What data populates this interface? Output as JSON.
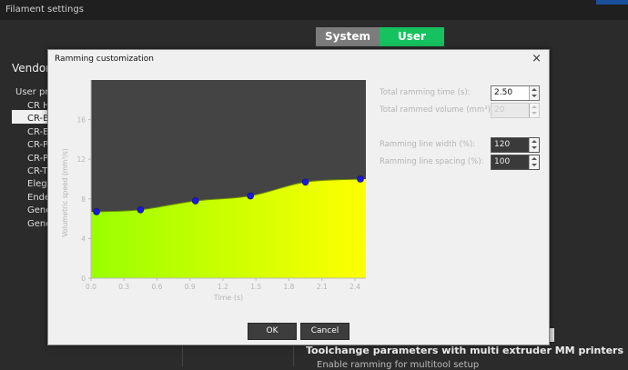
{
  "window": {
    "title": "Filament settings"
  },
  "mode_toggle": {
    "system": "System",
    "user": "User"
  },
  "sidebar": {
    "vendor_label": "Vendor",
    "user_presets_label": "User pre",
    "items": [
      "CR Hy",
      "CR-Er",
      "CR-Er",
      "CR-PE",
      "CR-PE",
      "CR-TP",
      "Elego",
      "Ender",
      "Gener",
      "Gener"
    ]
  },
  "background_section": {
    "title": "Toolchange parameters with multi extruder MM printers",
    "subtitle": "Enable ramming for multitool setup"
  },
  "dialog": {
    "title": "Ramming customization",
    "close_glyph": "×",
    "fields": {
      "total_ramming_time": {
        "label": "Total ramming time (s):",
        "value": "2.50"
      },
      "total_rammed_volume": {
        "label": "Total rammed volume (mm³):",
        "value": "20"
      },
      "ramming_line_width": {
        "label": "Ramming line width (%):",
        "value": "120"
      },
      "ramming_line_spacing": {
        "label": "Ramming line spacing (%):",
        "value": "100"
      }
    },
    "buttons": {
      "ok": "OK",
      "cancel": "Cancel"
    }
  },
  "chart_data": {
    "type": "area",
    "xlabel": "Time (s)",
    "ylabel": "Volumetric speed (mm³/s)",
    "xlim": [
      0,
      2.5
    ],
    "ylim": [
      0,
      20
    ],
    "xticks": [
      "0.0",
      "0.3",
      "0.6",
      "0.9",
      "1.2",
      "1.5",
      "1.8",
      "2.1",
      "2.4"
    ],
    "yticks": [
      "0",
      "4",
      "8",
      "12",
      "16"
    ],
    "points": [
      {
        "x": 0.05,
        "y": 6.7
      },
      {
        "x": 0.45,
        "y": 6.9
      },
      {
        "x": 0.95,
        "y": 7.8
      },
      {
        "x": 1.45,
        "y": 8.3
      },
      {
        "x": 1.95,
        "y": 9.7
      },
      {
        "x": 2.45,
        "y": 10.0
      }
    ],
    "colors": {
      "fill_low": "#99ff00",
      "fill_high": "#ffff00",
      "point": "#1a1adb",
      "plot_bg": "#444444"
    }
  }
}
